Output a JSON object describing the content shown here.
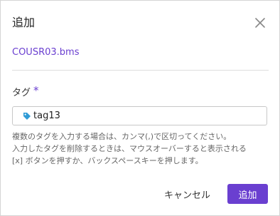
{
  "dialog": {
    "title": "追加",
    "close_icon": "close-icon",
    "file_name": "COUSR03.bms"
  },
  "tag_field": {
    "label": "タグ",
    "required_mark": "*",
    "tag_icon": "tag-icon",
    "tags": [
      "tag13"
    ],
    "help_lines": [
      "複数のタグを入力する場合は、カンマ(,)で区切ってください。",
      "入力したタグを削除するときは、マウスオーバーすると表示される",
      "[x] ボタンを押すか、バックスペースキーを押します。"
    ]
  },
  "actions": {
    "cancel_label": "キャンセル",
    "submit_label": "追加"
  },
  "colors": {
    "accent": "#6a3fd0",
    "tag_icon": "#2f9bd6"
  }
}
